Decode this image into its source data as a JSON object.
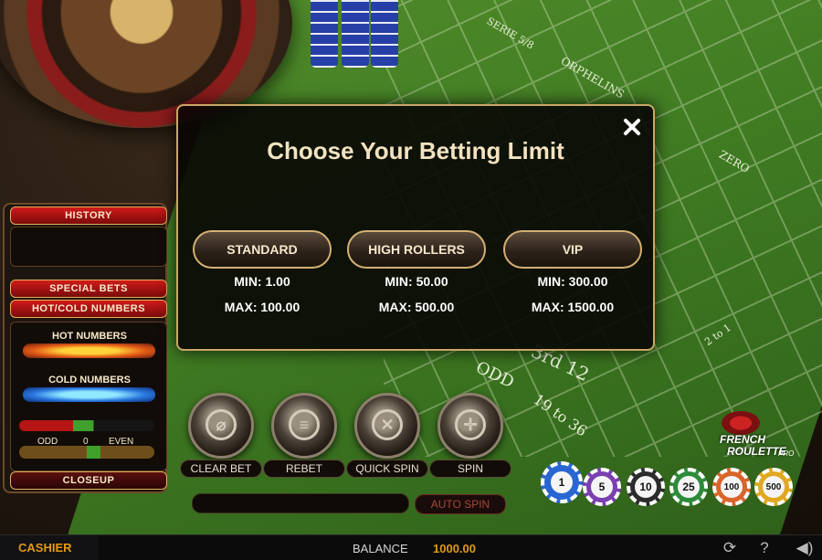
{
  "modal": {
    "title": "Choose Your Betting Limit",
    "limits": [
      {
        "label": "STANDARD",
        "min": "MIN: 1.00",
        "max": "MAX: 100.00"
      },
      {
        "label": "HIGH ROLLERS",
        "min": "MIN: 50.00",
        "max": "MAX: 500.00"
      },
      {
        "label": "VIP",
        "min": "MIN: 300.00",
        "max": "MAX: 1500.00"
      }
    ]
  },
  "side_panel": {
    "history": "HISTORY",
    "special_bets": "SPECIAL BETS",
    "hot_cold": "HOT/COLD NUMBERS",
    "hot_numbers": "HOT NUMBERS",
    "cold_numbers": "COLD NUMBERS",
    "odd": "ODD",
    "zero": "0",
    "even": "EVEN",
    "closeup": "CLOSEUP"
  },
  "controls": {
    "clear_bet": "CLEAR BET",
    "rebet": "REBET",
    "quick_spin": "QUICK SPIN",
    "spin": "SPIN",
    "auto_spin": "AUTO SPIN"
  },
  "chips": [
    "1",
    "5",
    "10",
    "25",
    "100",
    "500"
  ],
  "chip_colors": [
    "#2a66d1",
    "#7a3fb0",
    "#2c2c2c",
    "#2e8b3a",
    "#d8652a",
    "#e0a821"
  ],
  "logo": {
    "line1": "FRENCH",
    "line2": "ROULETTE",
    "pro": "PRO"
  },
  "bottom": {
    "cashier": "CASHIER",
    "balance_label": "BALANCE",
    "balance_value": "1000.00"
  },
  "table_labels": {
    "serie": "SERIE 5/8",
    "orphelins": "ORPHELINS",
    "zero": "ZERO",
    "odd": "ODD",
    "third12": "3rd 12",
    "range": "19 to 36",
    "two_to_one": "2 to 1"
  },
  "icons": [
    "refresh-icon",
    "help-icon",
    "sound-icon",
    "close-icon"
  ]
}
